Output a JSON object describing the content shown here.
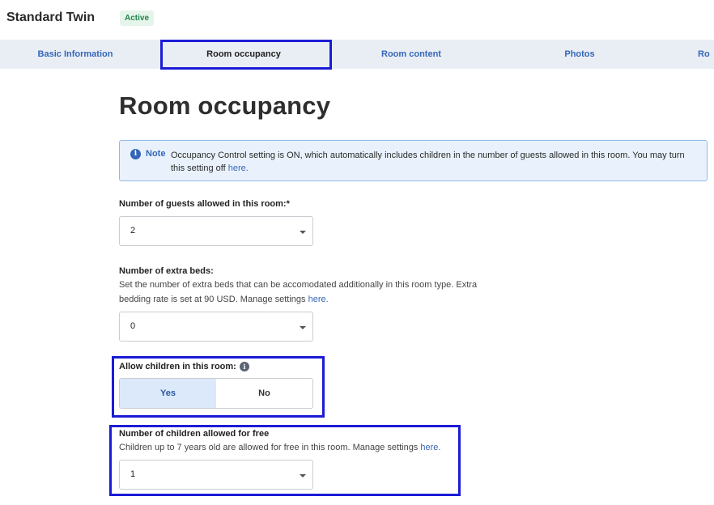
{
  "header": {
    "room_title": "Standard Twin",
    "status": "Active"
  },
  "tabs": [
    {
      "label": "Basic Information"
    },
    {
      "label": "Room occupancy"
    },
    {
      "label": "Room content"
    },
    {
      "label": "Photos"
    },
    {
      "label": "Ro"
    }
  ],
  "page": {
    "title": "Room occupancy"
  },
  "note": {
    "label": "Note",
    "text": "Occupancy Control setting is ON, which automatically includes children in the number of guests allowed in this room. You may turn this setting off ",
    "link": "here."
  },
  "guests": {
    "label": "Number of guests allowed in this room:*",
    "value": "2"
  },
  "extra_beds": {
    "label": "Number of extra beds:",
    "description_line1": "Set the number of extra beds that can be accomodated additionally in this room type. Extra",
    "description_line2": "bedding rate is set at 90 USD. Manage settings ",
    "link": "here.",
    "value": "0"
  },
  "children": {
    "label": "Allow children in this room:",
    "help_icon": "info-icon",
    "yes_label": "Yes",
    "no_label": "No",
    "selected": "Yes"
  },
  "children_free": {
    "label": "Number of children allowed for free",
    "description": "Children up to 7 years old are allowed for free in this room. Manage settings ",
    "link": "here.",
    "value": "1"
  },
  "colors": {
    "accent": "#3566b8",
    "highlight_border": "#1b1bd6",
    "note_bg": "#e9f2fc",
    "active_badge": "#22844a",
    "tabbar_bg": "#e9eef5"
  }
}
